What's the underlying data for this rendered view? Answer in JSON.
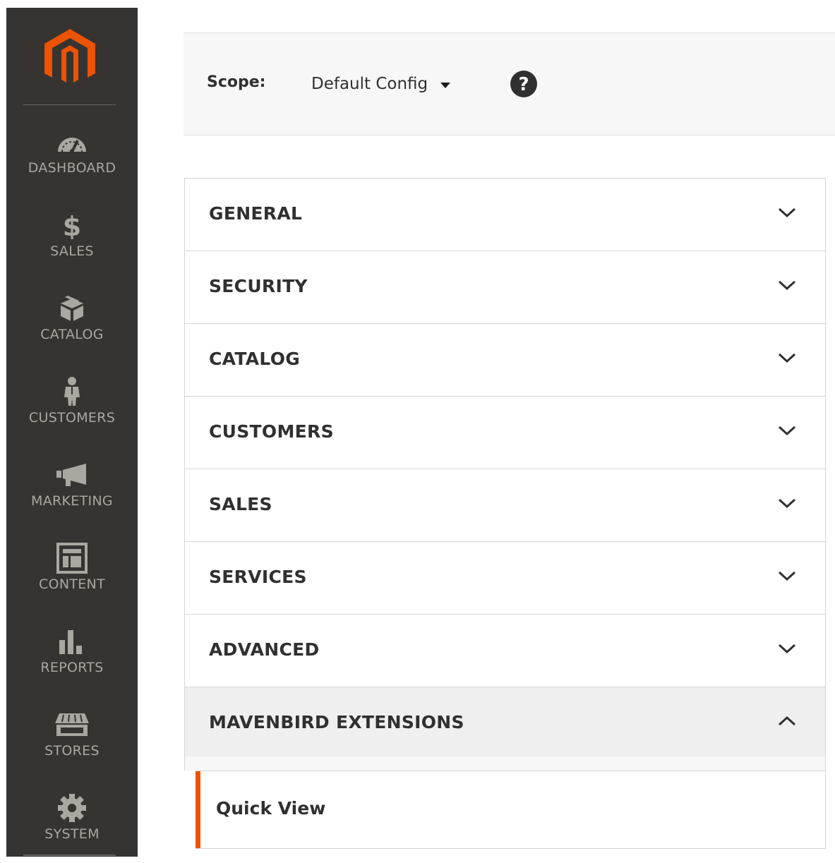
{
  "sidebar": {
    "logo": "magento-logo",
    "brand_color": "#eb5202",
    "items": [
      {
        "label": "DASHBOARD",
        "icon": "speedometer-icon"
      },
      {
        "label": "SALES",
        "icon": "dollar-icon"
      },
      {
        "label": "CATALOG",
        "icon": "box-icon"
      },
      {
        "label": "CUSTOMERS",
        "icon": "person-icon"
      },
      {
        "label": "MARKETING",
        "icon": "megaphone-icon"
      },
      {
        "label": "CONTENT",
        "icon": "layout-icon"
      },
      {
        "label": "REPORTS",
        "icon": "bar-chart-icon"
      },
      {
        "label": "STORES",
        "icon": "storefront-icon"
      },
      {
        "label": "SYSTEM",
        "icon": "gear-icon"
      }
    ]
  },
  "scope": {
    "label": "Scope:",
    "value": "Default Config",
    "help_icon": "question-circle-icon"
  },
  "config": {
    "sections": [
      {
        "title": "GENERAL",
        "expanded": false
      },
      {
        "title": "SECURITY",
        "expanded": false
      },
      {
        "title": "CATALOG",
        "expanded": false
      },
      {
        "title": "CUSTOMERS",
        "expanded": false
      },
      {
        "title": "SALES",
        "expanded": false
      },
      {
        "title": "SERVICES",
        "expanded": false
      },
      {
        "title": "ADVANCED",
        "expanded": false
      },
      {
        "title": "MAVENBIRD EXTENSIONS",
        "expanded": true
      }
    ],
    "sub_items": [
      {
        "label": "Quick View",
        "active": true
      }
    ]
  }
}
